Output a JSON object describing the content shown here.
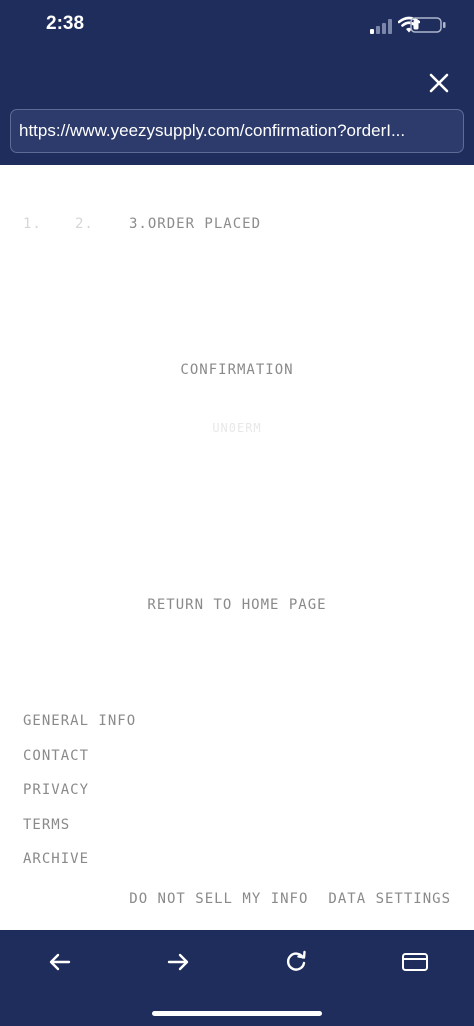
{
  "status_bar": {
    "time": "2:38",
    "icons": [
      "cellular-signal-icon",
      "wifi-icon",
      "battery-icon"
    ]
  },
  "browser": {
    "url": "https://www.yeezysupply.com/confirmation?orderI...",
    "close_icon": "close-icon"
  },
  "checkout": {
    "steps": [
      {
        "label": "1."
      },
      {
        "label": "2."
      },
      {
        "label": "3.ORDER PLACED"
      }
    ],
    "title": "CONFIRMATION",
    "order_number": "UN0ERM",
    "return_link": "RETURN TO HOME PAGE"
  },
  "footer": {
    "links": [
      "GENERAL INFO",
      "CONTACT",
      "PRIVACY",
      "TERMS",
      "ARCHIVE"
    ],
    "bottom_links": [
      "DO NOT SELL MY INFO",
      "DATA SETTINGS"
    ]
  },
  "toolbar": {
    "icons": [
      "back-arrow-icon",
      "forward-arrow-icon",
      "reload-icon",
      "card-icon"
    ]
  },
  "colors": {
    "bar_background": "#1f2d5c",
    "text_gray": "#8a8a8a",
    "text_faded": "#d6d6d6"
  }
}
